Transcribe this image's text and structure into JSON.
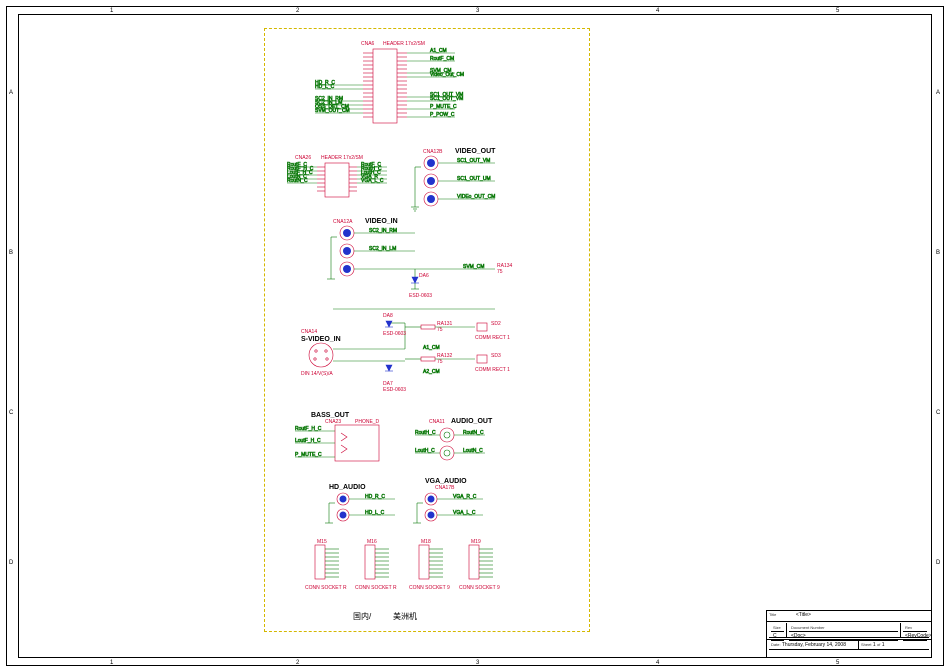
{
  "grid": {
    "cols": [
      "1",
      "2",
      "3",
      "4",
      "5"
    ],
    "rows": [
      "A",
      "B",
      "C",
      "D"
    ]
  },
  "sections": {
    "header1": {
      "ref": "CNA6",
      "type": "HEADER 17x2/SM"
    },
    "header2": {
      "ref": "CNA26",
      "type": "HEADER 17x2/SM"
    },
    "video_out": {
      "ref": "CNA12B",
      "title": "VIDEO_OUT",
      "nets": [
        "SC1_OUT_VM",
        "SC1_OUT_UM",
        "VIDEo_OUT_CM"
      ]
    },
    "video_in": {
      "ref": "CNA12A",
      "title": "VIDEO_IN",
      "nets": [
        "SC2_IN_RM",
        "SC2_IN_LM"
      ],
      "diode": "DA6",
      "diode_part": "ESD-0603",
      "r": "RA134",
      "r_val": "75",
      "net_svm": "SVM_CM"
    },
    "svideo": {
      "ref": "CNA14",
      "title": "S-VIDEO_IN",
      "din_label": "DIN 14/V(S)/A",
      "d": [
        "DA8",
        "DA7"
      ],
      "d_part": "ESD-0603",
      "r": [
        "RA131",
        "RA132"
      ],
      "r_val": "75",
      "net": [
        "A1_CM",
        "A2_CM"
      ],
      "comp": [
        "SD2",
        "SD3"
      ],
      "comp_type": [
        "COMM RECT 1",
        "COMM RECT 1"
      ]
    },
    "bass_out": {
      "title": "BASS_OUT",
      "ref": "CNA23",
      "jack": "PHONE_D",
      "nets_in": [
        "RoutF_H_C",
        "LoutF_H_C",
        "P_MUTE_C"
      ]
    },
    "audio_out": {
      "ref": "CNA11",
      "title": "AUDIO_OUT",
      "nets": [
        "RoutH_C",
        "LoutH_C",
        "RoutN_C",
        "LoutN_C"
      ]
    },
    "hd_audio": {
      "title": "HD_AUDIO",
      "nets": [
        "HD_R_C",
        "HD_L_C"
      ]
    },
    "vga_audio": {
      "ref": "CNA17B",
      "title": "VGA_AUDIO",
      "nets": [
        "VGA_R_C",
        "VGA_L_C"
      ]
    },
    "sockets": {
      "refs": [
        "M15",
        "M16",
        "M18",
        "M19"
      ],
      "types": [
        "CONN SOCKET R",
        "CONN SOCKET R",
        "CONN SOCKET 9",
        "CONN SOCKET 9"
      ]
    },
    "header1_nets_left": [
      "HD_R_C",
      "HD_L_C",
      "SC2_IN_RM",
      "SC2_IN_LM",
      "OSS_DET_CM",
      "SVM_OUT_CM"
    ],
    "header1_nets_right": [
      "A1_CM",
      "RoutF_CM",
      "SVM_CM",
      "Video_Out_CM",
      "SC1_OUT_VM",
      "SC1_OUT_VM",
      "P_MUTE_C",
      "P_POW_C"
    ],
    "header2_nets_left": [
      "RoutF_C",
      "RoutF_H_C",
      "LoutF_H_C",
      "LoutN_C",
      "RoutN_C"
    ],
    "header2_nets_right": [
      "RoutF_C",
      "RoutH_C",
      "LoutH_C",
      "VGA_R",
      "VGA_L_C"
    ]
  },
  "footer_text": {
    "a": "国内/",
    "b": "美洲机"
  },
  "titleblock": {
    "title_label": "Title",
    "title": "<Title>",
    "size_label": "Size",
    "size": "C",
    "docnum_label": "Document Number",
    "docnum": "<Doc>",
    "rev_label": "Rev",
    "rev": "<RevCode>",
    "date_label": "Date:",
    "date": "Thursday, February 14, 2008",
    "sheet_label": "Sheet",
    "sheet": "1",
    "of_label": "of",
    "of": "1"
  }
}
